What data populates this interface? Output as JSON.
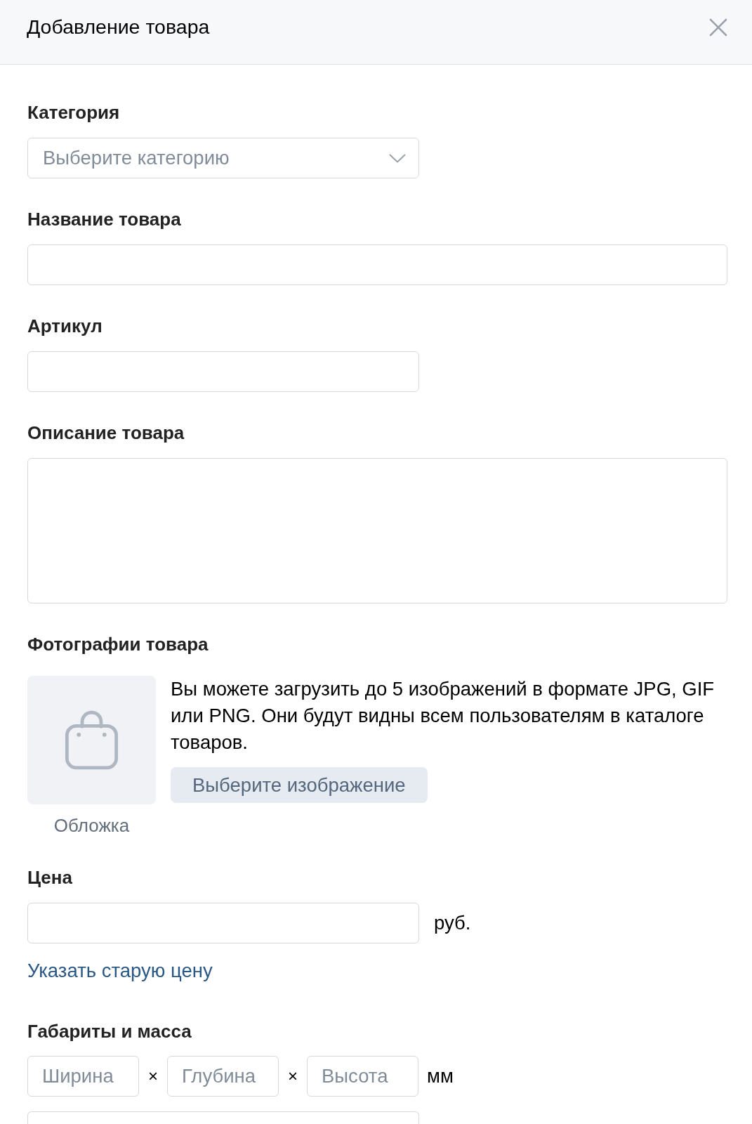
{
  "window": {
    "title": "Добавление товара"
  },
  "category": {
    "label": "Категория",
    "placeholder": "Выберите категорию"
  },
  "name": {
    "label": "Название товара"
  },
  "sku": {
    "label": "Артикул"
  },
  "description": {
    "label": "Описание товара"
  },
  "photos": {
    "label": "Фотографии товара",
    "cover_caption": "Обложка",
    "hint": "Вы можете загрузить до 5 изображений в формате JPG, GIF или PNG. Они будут видны всем пользователям в каталоге товаров.",
    "button": "Выберите изображение"
  },
  "price": {
    "label": "Цена",
    "unit": "руб.",
    "old_price_link": "Указать старую цену"
  },
  "dimensions": {
    "label": "Габариты и масса",
    "fields": [
      {
        "placeholder": "Ширина",
        "separator": "×"
      },
      {
        "placeholder": "Глубина",
        "separator": "×"
      },
      {
        "placeholder": "Высота"
      }
    ],
    "unit": "мм"
  }
}
